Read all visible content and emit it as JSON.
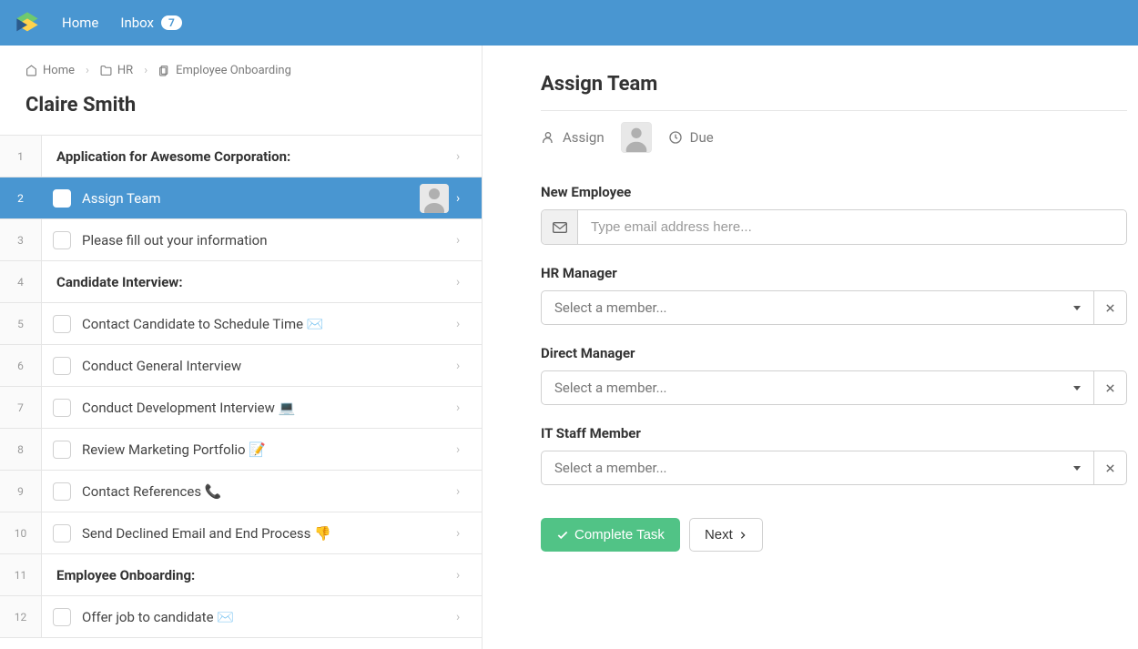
{
  "header": {
    "home_label": "Home",
    "inbox_label": "Inbox",
    "inbox_count": "7"
  },
  "breadcrumbs": {
    "home": "Home",
    "folder": "HR",
    "item": "Employee Onboarding"
  },
  "page_title": "Claire Smith",
  "tasks": [
    {
      "num": "1",
      "label": "Application for Awesome Corporation:",
      "section": true
    },
    {
      "num": "2",
      "label": "Assign Team",
      "active": true,
      "avatar": true,
      "check": true
    },
    {
      "num": "3",
      "label": "Please fill out your information",
      "check": true
    },
    {
      "num": "4",
      "label": "Candidate Interview:",
      "section": true
    },
    {
      "num": "5",
      "label": "Contact Candidate to Schedule Time ✉️",
      "check": true
    },
    {
      "num": "6",
      "label": "Conduct General Interview",
      "check": true
    },
    {
      "num": "7",
      "label": "Conduct Development Interview 💻",
      "check": true
    },
    {
      "num": "8",
      "label": "Review Marketing Portfolio 📝",
      "check": true
    },
    {
      "num": "9",
      "label": "Contact References 📞",
      "check": true
    },
    {
      "num": "10",
      "label": "Send Declined Email and End Process 👎",
      "check": true
    },
    {
      "num": "11",
      "label": "Employee Onboarding:",
      "section": true
    },
    {
      "num": "12",
      "label": "Offer job to candidate ✉️",
      "check": true
    }
  ],
  "panel": {
    "title": "Assign Team",
    "assign_label": "Assign",
    "due_label": "Due",
    "fields": {
      "new_employee_label": "New Employee",
      "new_employee_placeholder": "Type email address here...",
      "hr_manager_label": "HR Manager",
      "direct_manager_label": "Direct Manager",
      "it_staff_label": "IT Staff Member",
      "select_placeholder": "Select a member..."
    },
    "complete_label": "Complete Task",
    "next_label": "Next"
  }
}
